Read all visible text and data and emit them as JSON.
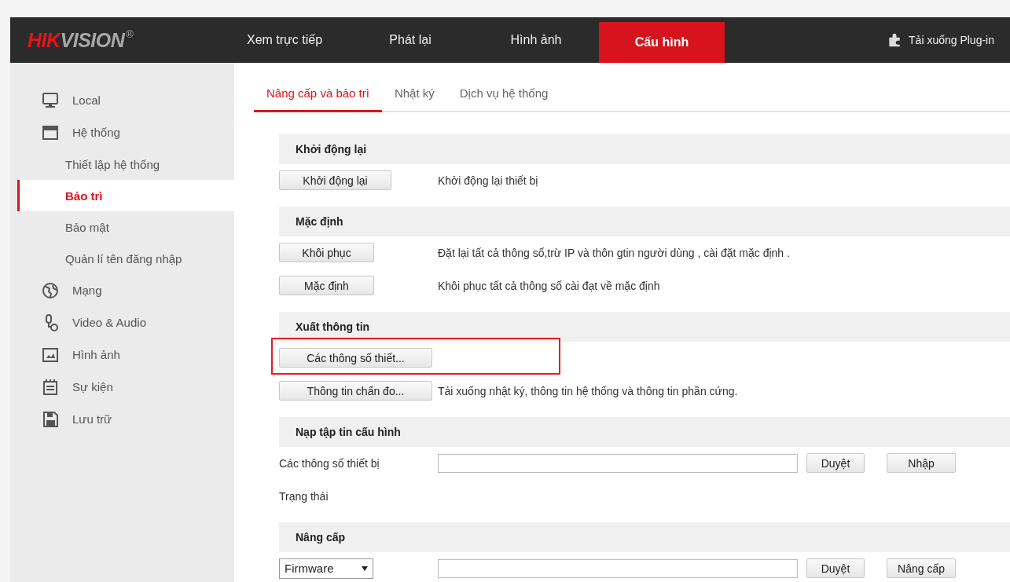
{
  "logo": {
    "first": "HIK",
    "rest": "VISION",
    "mark": "®"
  },
  "nav": [
    {
      "label": "Xem trực tiếp",
      "selected": false
    },
    {
      "label": "Phát lại",
      "selected": false
    },
    {
      "label": "Hình ảnh",
      "selected": false
    },
    {
      "label": "Cấu hình",
      "selected": true
    }
  ],
  "plugin_link": "Tải xuống Plug-in",
  "sidebar": {
    "items": [
      {
        "label": "Local",
        "selected": false
      },
      {
        "label": "Hệ thống",
        "selected": false,
        "children": [
          {
            "label": "Thiết lập hệ thống",
            "selected": false
          },
          {
            "label": "Bảo trì",
            "selected": true
          },
          {
            "label": "Bảo mật",
            "selected": false
          },
          {
            "label": "Quản lí tên đăng nhập",
            "selected": false
          }
        ]
      },
      {
        "label": "Mạng",
        "selected": false
      },
      {
        "label": "Video & Audio",
        "selected": false
      },
      {
        "label": "Hình ảnh",
        "selected": false
      },
      {
        "label": "Sự kiện",
        "selected": false
      },
      {
        "label": "Lưu trữ",
        "selected": false
      }
    ]
  },
  "tabs": [
    {
      "label": "Nâng cấp và bảo trì",
      "selected": true
    },
    {
      "label": "Nhật ký",
      "selected": false
    },
    {
      "label": "Dịch vụ hệ thống",
      "selected": false
    }
  ],
  "sections": [
    {
      "title": "Khởi động lại",
      "rows": [
        {
          "kind": "action",
          "button": "Khởi động lại",
          "description": "Khởi động lại thiết bị",
          "highlighted": false
        }
      ]
    },
    {
      "title": "Mặc định",
      "rows": [
        {
          "kind": "action",
          "button": "Khôi phục",
          "description": "Đặt lại tất cả thông số,trừ IP và thôn gtin người dùng , cài đặt mặc định .",
          "highlighted": false
        },
        {
          "kind": "action",
          "button": "Mặc định",
          "description": "Khôi phục tất cả thông số cài đạt về mặc định",
          "highlighted": false
        }
      ]
    },
    {
      "title": "Xuất thông tin",
      "rows": [
        {
          "kind": "action",
          "button": "Các thông số thiết...",
          "highlighted": true
        },
        {
          "kind": "action",
          "button": "Thông tin chẩn đo...",
          "description": "Tải xuống nhật ký, thông tin hệ thống và thông tin phần cứng.",
          "highlighted": false
        }
      ]
    },
    {
      "title": "Nạp tập tin cấu hình",
      "rows": [
        {
          "kind": "file",
          "label": "Các thông số thiết bị",
          "buttons": [
            "Duyệt",
            "Nhập"
          ]
        },
        {
          "kind": "label",
          "label": "Trạng thái"
        }
      ]
    },
    {
      "title": "Nâng cấp",
      "rows": [
        {
          "kind": "file",
          "select": "Firmware",
          "buttons": [
            "Duyệt",
            "Nâng cấp"
          ]
        }
      ]
    }
  ]
}
